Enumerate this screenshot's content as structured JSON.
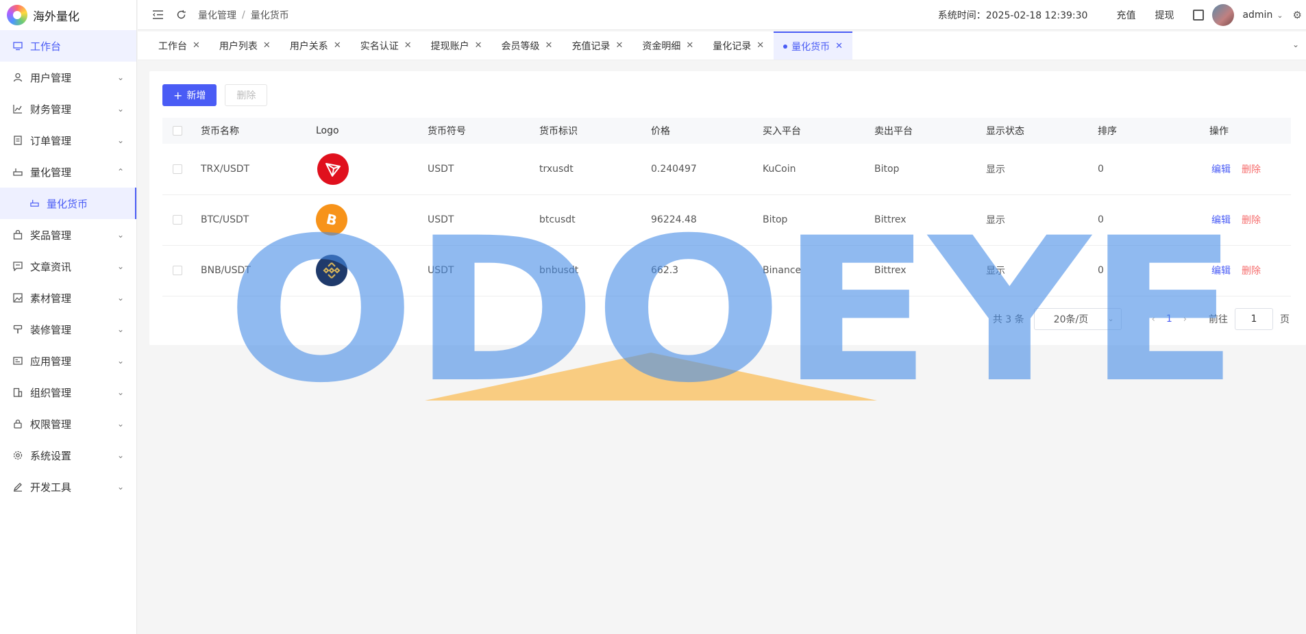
{
  "app": {
    "name": "海外量化",
    "logo_icon": "logo-icon"
  },
  "sidebar": {
    "items": [
      {
        "label": "工作台",
        "icon": "monitor-icon",
        "expanded": null
      },
      {
        "label": "用户管理",
        "icon": "user-icon",
        "expanded": false
      },
      {
        "label": "财务管理",
        "icon": "chart-icon",
        "expanded": false
      },
      {
        "label": "订单管理",
        "icon": "document-icon",
        "expanded": false
      },
      {
        "label": "量化管理",
        "icon": "robot-icon",
        "expanded": true
      },
      {
        "label": "奖品管理",
        "icon": "bag-icon",
        "expanded": false
      },
      {
        "label": "文章资讯",
        "icon": "message-icon",
        "expanded": false
      },
      {
        "label": "素材管理",
        "icon": "image-icon",
        "expanded": false
      },
      {
        "label": "装修管理",
        "icon": "brush-icon",
        "expanded": false
      },
      {
        "label": "应用管理",
        "icon": "app-icon",
        "expanded": false
      },
      {
        "label": "组织管理",
        "icon": "building-icon",
        "expanded": false
      },
      {
        "label": "权限管理",
        "icon": "lock-icon",
        "expanded": false
      },
      {
        "label": "系统设置",
        "icon": "gear-icon",
        "expanded": false
      },
      {
        "label": "开发工具",
        "icon": "pen-icon",
        "expanded": false
      }
    ],
    "sub_item": {
      "label": "量化货币",
      "icon": "robot-icon"
    }
  },
  "topbar": {
    "breadcrumb": [
      "量化管理",
      "量化货币"
    ],
    "breadcrumb_sep": "/",
    "system_time": "系统时间：2025-02-18 12:39:30",
    "recharge": "充值",
    "withdraw": "提现",
    "user": "admin"
  },
  "tabs": [
    {
      "label": "工作台",
      "active": false
    },
    {
      "label": "用户列表",
      "active": false
    },
    {
      "label": "用户关系",
      "active": false
    },
    {
      "label": "实名认证",
      "active": false
    },
    {
      "label": "提现账户",
      "active": false
    },
    {
      "label": "会员等级",
      "active": false
    },
    {
      "label": "充值记录",
      "active": false
    },
    {
      "label": "资金明细",
      "active": false
    },
    {
      "label": "量化记录",
      "active": false
    },
    {
      "label": "量化货币",
      "active": true
    }
  ],
  "toolbar": {
    "add_label": "新增",
    "delete_label": "删除"
  },
  "table": {
    "columns": [
      "货币名称",
      "Logo",
      "货币符号",
      "货币标识",
      "价格",
      "买入平台",
      "卖出平台",
      "显示状态",
      "排序",
      "操作"
    ],
    "rows": [
      {
        "name": "TRX/USDT",
        "logo": "tron-icon",
        "symbol": "USDT",
        "ident": "trxusdt",
        "price": "0.240497",
        "buy": "KuCoin",
        "sell": "Bitop",
        "status": "显示",
        "sort": "0"
      },
      {
        "name": "BTC/USDT",
        "logo": "bitcoin-icon",
        "symbol": "USDT",
        "ident": "btcusdt",
        "price": "96224.48",
        "buy": "Bitop",
        "sell": "Bittrex",
        "status": "显示",
        "sort": "0"
      },
      {
        "name": "BNB/USDT",
        "logo": "binance-icon",
        "symbol": "USDT",
        "ident": "bnbusdt",
        "price": "662.3",
        "buy": "Binance",
        "sell": "Bittrex",
        "status": "显示",
        "sort": "0"
      }
    ],
    "edit_label": "编辑",
    "delete_label": "删除"
  },
  "pagination": {
    "total": "共 3 条",
    "page_size": "20条/页",
    "current_page": "1",
    "goto_label": "前往",
    "goto_value": "1",
    "page_suffix": "页"
  },
  "watermark": {
    "text": "ODOEYE"
  },
  "colors": {
    "accent": "#4a5cf5",
    "danger": "#f56c6c"
  }
}
